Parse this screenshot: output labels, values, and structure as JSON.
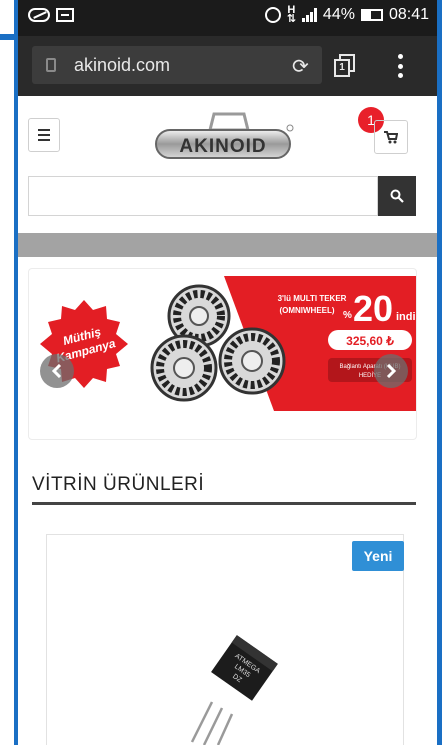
{
  "status_bar": {
    "network": "H",
    "battery_text": "44%",
    "battery_level": 0.44,
    "time": "08:41"
  },
  "browser": {
    "url": "akinoid.com",
    "tab_count": "1"
  },
  "header": {
    "logo_text": "AKINOID",
    "cart_count": "1"
  },
  "search": {
    "placeholder": ""
  },
  "banner": {
    "badge_line1": "Müthiş",
    "badge_line2": "Kampanya",
    "product_line1": "3'lü MULTI TEKER",
    "product_line2": "(OMNIWHEEL)",
    "percent_sign": "%",
    "discount": "20",
    "discount_suffix": "indi",
    "price": "325,60 ₺",
    "gift_line1": "Bağlantı Aparatı (HUB)",
    "gift_line2": "HEDİYE"
  },
  "section": {
    "title": "VİTRİN ÜRÜNLERİ"
  },
  "product": {
    "badge": "Yeni",
    "chip_text_line1": "ATMEGA",
    "chip_text_line2": "LM35",
    "chip_text_line3": "DZ"
  },
  "colors": {
    "accent_blue": "#2f8fd6",
    "badge_red": "#e8202a",
    "banner_red": "#e31e24",
    "frame_blue": "#1a6fc4"
  }
}
